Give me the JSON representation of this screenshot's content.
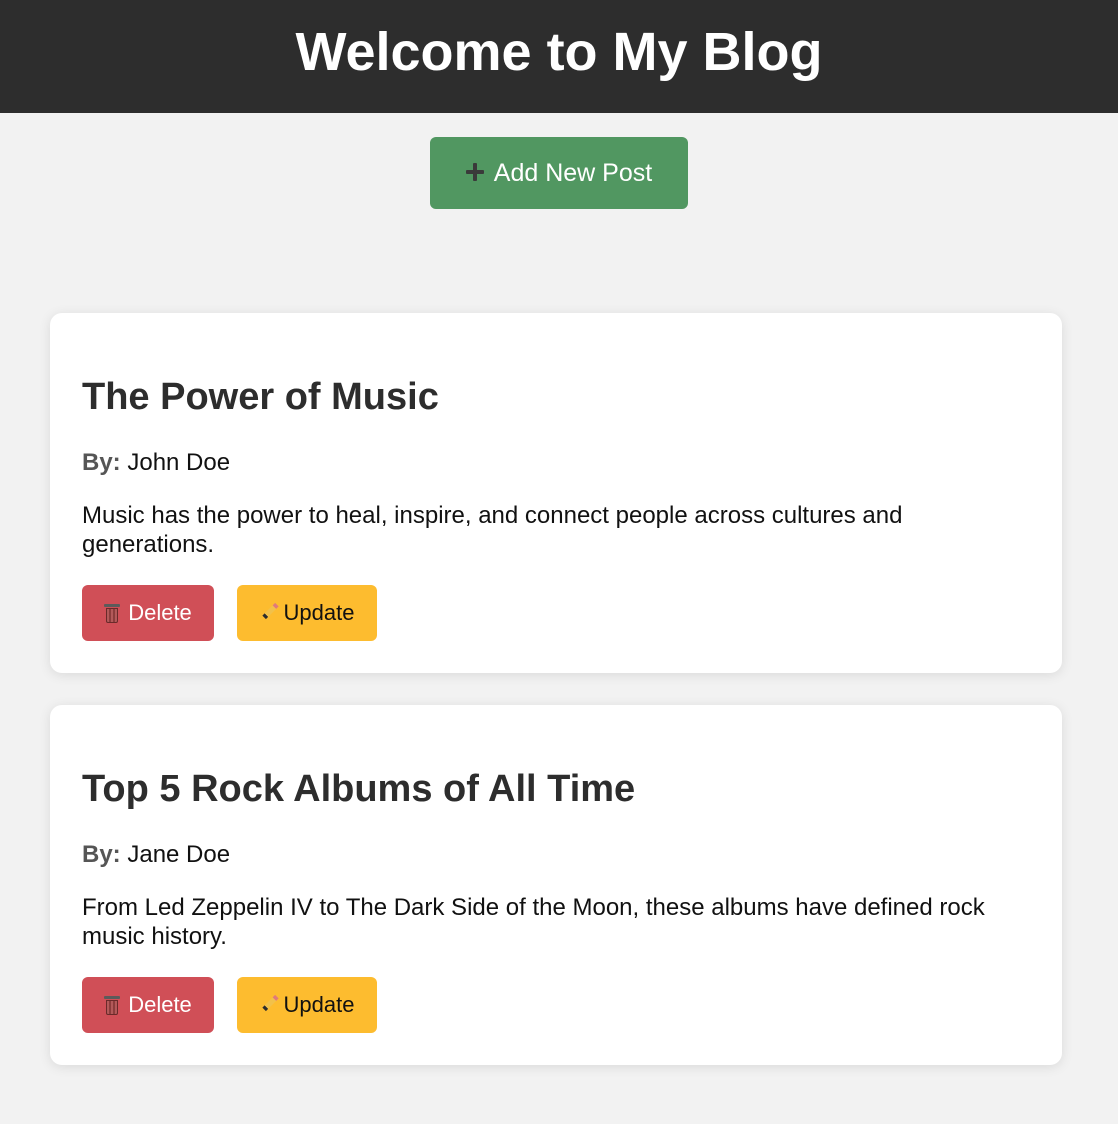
{
  "header": {
    "title": "Welcome to My Blog"
  },
  "toolbar": {
    "add_post_label": "Add New Post",
    "add_icon": "plus-icon"
  },
  "posts": [
    {
      "title": "The Power of Music",
      "author_label": "By:",
      "author": "John Doe",
      "body": "Music has the power to heal, inspire, and connect people across cultures and generations.",
      "delete_label": "Delete",
      "update_label": "Update"
    },
    {
      "title": "Top 5 Rock Albums of All Time",
      "author_label": "By:",
      "author": "Jane Doe",
      "body": "From Led Zeppelin IV to The Dark Side of the Moon, these albums have defined rock music history.",
      "delete_label": "Delete",
      "update_label": "Update"
    }
  ],
  "colors": {
    "header_bg": "#2d2d2d",
    "add_button": "#519761",
    "delete_button": "#d04f57",
    "update_button": "#fdbc2f",
    "page_bg": "#f2f2f2"
  }
}
